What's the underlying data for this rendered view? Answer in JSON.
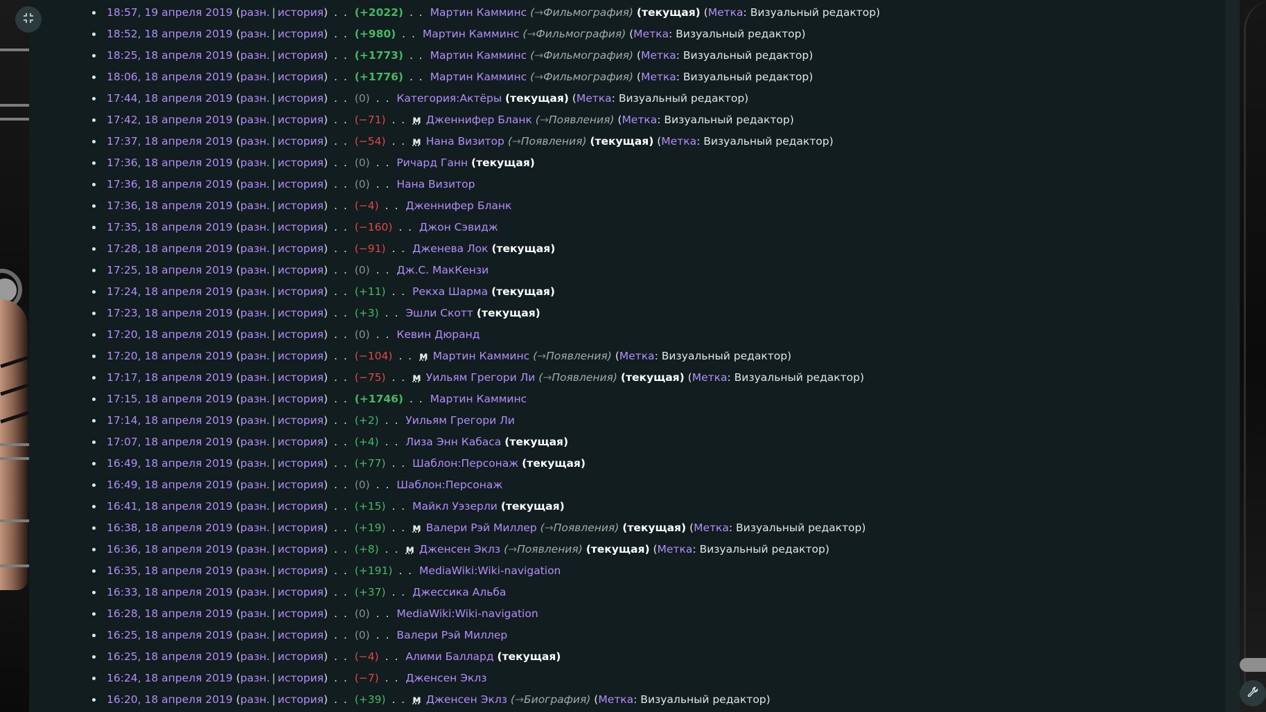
{
  "labels": {
    "diff": "разн.",
    "hist": "история",
    "current": "(текущая)",
    "tag_word": "Метка",
    "tag_value": ": Визуальный редактор)",
    "minor": "м",
    "arrow": "→"
  },
  "icons": {
    "collapse": "collapse-icon",
    "tools": "wrench-icon"
  },
  "colors": {
    "link": "#b58cff",
    "positive": "#45b865",
    "negative": "#e24646",
    "neutral": "#8a9292",
    "background": "#111d1e"
  },
  "changes": [
    {
      "time": "18:57, 19 апреля 2019",
      "size": "(+2022)",
      "kind": "pos-big",
      "minor": false,
      "page": "Мартин Камминс",
      "section": "Фильмография",
      "current": true,
      "tag": true
    },
    {
      "time": "18:52, 18 апреля 2019",
      "size": "(+980)",
      "kind": "pos-big",
      "minor": false,
      "page": "Мартин Камминс",
      "section": "Фильмография",
      "current": false,
      "tag": true
    },
    {
      "time": "18:25, 18 апреля 2019",
      "size": "(+1773)",
      "kind": "pos-big",
      "minor": false,
      "page": "Мартин Камминс",
      "section": "Фильмография",
      "current": false,
      "tag": true
    },
    {
      "time": "18:06, 18 апреля 2019",
      "size": "(+1776)",
      "kind": "pos-big",
      "minor": false,
      "page": "Мартин Камминс",
      "section": "Фильмография",
      "current": false,
      "tag": true
    },
    {
      "time": "17:44, 18 апреля 2019",
      "size": "(0)",
      "kind": "neu",
      "minor": false,
      "page": "Категория:Актёры",
      "section": "",
      "current": true,
      "tag": true
    },
    {
      "time": "17:42, 18 апреля 2019",
      "size": "(−71)",
      "kind": "neg",
      "minor": true,
      "page": "Дженнифер Бланк",
      "section": "Появления",
      "current": false,
      "tag": true
    },
    {
      "time": "17:37, 18 апреля 2019",
      "size": "(−54)",
      "kind": "neg",
      "minor": true,
      "page": "Нана Визитор",
      "section": "Появления",
      "current": true,
      "tag": true
    },
    {
      "time": "17:36, 18 апреля 2019",
      "size": "(0)",
      "kind": "neu",
      "minor": false,
      "page": "Ричард Ганн",
      "section": "",
      "current": true,
      "tag": false
    },
    {
      "time": "17:36, 18 апреля 2019",
      "size": "(0)",
      "kind": "neu",
      "minor": false,
      "page": "Нана Визитор",
      "section": "",
      "current": false,
      "tag": false
    },
    {
      "time": "17:36, 18 апреля 2019",
      "size": "(−4)",
      "kind": "neg",
      "minor": false,
      "page": "Дженнифер Бланк",
      "section": "",
      "current": false,
      "tag": false
    },
    {
      "time": "17:35, 18 апреля 2019",
      "size": "(−160)",
      "kind": "neg",
      "minor": false,
      "page": "Джон Сэвидж",
      "section": "",
      "current": false,
      "tag": false
    },
    {
      "time": "17:28, 18 апреля 2019",
      "size": "(−91)",
      "kind": "neg",
      "minor": false,
      "page": "Дженева Лок",
      "section": "",
      "current": true,
      "tag": false
    },
    {
      "time": "17:25, 18 апреля 2019",
      "size": "(0)",
      "kind": "neu",
      "minor": false,
      "page": "Дж.С. МакКензи",
      "section": "",
      "current": false,
      "tag": false
    },
    {
      "time": "17:24, 18 апреля 2019",
      "size": "(+11)",
      "kind": "pos",
      "minor": false,
      "page": "Рекха Шарма",
      "section": "",
      "current": true,
      "tag": false
    },
    {
      "time": "17:23, 18 апреля 2019",
      "size": "(+3)",
      "kind": "pos",
      "minor": false,
      "page": "Эшли Скотт",
      "section": "",
      "current": true,
      "tag": false
    },
    {
      "time": "17:20, 18 апреля 2019",
      "size": "(0)",
      "kind": "neu",
      "minor": false,
      "page": "Кевин Дюранд",
      "section": "",
      "current": false,
      "tag": false
    },
    {
      "time": "17:20, 18 апреля 2019",
      "size": "(−104)",
      "kind": "neg",
      "minor": true,
      "page": "Мартин Камминс",
      "section": "Появления",
      "current": false,
      "tag": true
    },
    {
      "time": "17:17, 18 апреля 2019",
      "size": "(−75)",
      "kind": "neg",
      "minor": true,
      "page": "Уильям Грегори Ли",
      "section": "Появления",
      "current": true,
      "tag": true
    },
    {
      "time": "17:15, 18 апреля 2019",
      "size": "(+1746)",
      "kind": "pos-big",
      "minor": false,
      "page": "Мартин Камминс",
      "section": "",
      "current": false,
      "tag": false
    },
    {
      "time": "17:14, 18 апреля 2019",
      "size": "(+2)",
      "kind": "pos",
      "minor": false,
      "page": "Уильям Грегори Ли",
      "section": "",
      "current": false,
      "tag": false
    },
    {
      "time": "17:07, 18 апреля 2019",
      "size": "(+4)",
      "kind": "pos",
      "minor": false,
      "page": "Лиза Энн Кабаса",
      "section": "",
      "current": true,
      "tag": false
    },
    {
      "time": "16:49, 18 апреля 2019",
      "size": "(+77)",
      "kind": "pos",
      "minor": false,
      "page": "Шаблон:Персонаж",
      "section": "",
      "current": true,
      "tag": false
    },
    {
      "time": "16:49, 18 апреля 2019",
      "size": "(0)",
      "kind": "neu",
      "minor": false,
      "page": "Шаблон:Персонаж",
      "section": "",
      "current": false,
      "tag": false
    },
    {
      "time": "16:41, 18 апреля 2019",
      "size": "(+15)",
      "kind": "pos",
      "minor": false,
      "page": "Майкл Уэзерли",
      "section": "",
      "current": true,
      "tag": false
    },
    {
      "time": "16:38, 18 апреля 2019",
      "size": "(+19)",
      "kind": "pos",
      "minor": true,
      "page": "Валери Рэй Миллер",
      "section": "Появления",
      "current": true,
      "tag": true
    },
    {
      "time": "16:36, 18 апреля 2019",
      "size": "(+8)",
      "kind": "pos",
      "minor": true,
      "page": "Дженсен Эклз",
      "section": "Появления",
      "current": true,
      "tag": true
    },
    {
      "time": "16:35, 18 апреля 2019",
      "size": "(+191)",
      "kind": "pos",
      "minor": false,
      "page": "MediaWiki:Wiki-navigation",
      "section": "",
      "current": false,
      "tag": false
    },
    {
      "time": "16:33, 18 апреля 2019",
      "size": "(+37)",
      "kind": "pos",
      "minor": false,
      "page": "Джессика Альба",
      "section": "",
      "current": false,
      "tag": false
    },
    {
      "time": "16:28, 18 апреля 2019",
      "size": "(0)",
      "kind": "neu",
      "minor": false,
      "page": "MediaWiki:Wiki-navigation",
      "section": "",
      "current": false,
      "tag": false
    },
    {
      "time": "16:25, 18 апреля 2019",
      "size": "(0)",
      "kind": "neu",
      "minor": false,
      "page": "Валери Рэй Миллер",
      "section": "",
      "current": false,
      "tag": false
    },
    {
      "time": "16:25, 18 апреля 2019",
      "size": "(−4)",
      "kind": "neg",
      "minor": false,
      "page": "Алими Баллард",
      "section": "",
      "current": true,
      "tag": false
    },
    {
      "time": "16:24, 18 апреля 2019",
      "size": "(−7)",
      "kind": "neg",
      "minor": false,
      "page": "Дженсен Эклз",
      "section": "",
      "current": false,
      "tag": false
    },
    {
      "time": "16:20, 18 апреля 2019",
      "size": "(+39)",
      "kind": "pos",
      "minor": true,
      "page": "Дженсен Эклз",
      "section": "Биография",
      "current": false,
      "tag": true
    }
  ]
}
